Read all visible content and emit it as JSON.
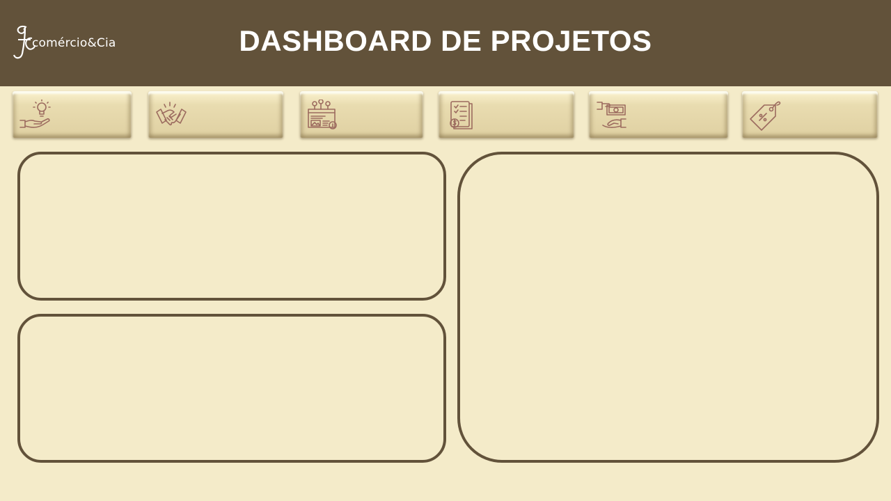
{
  "header": {
    "logo_text": "comércio&Cia",
    "title": "DASHBOARD DE PROJETOS"
  },
  "nav_buttons": [
    {
      "icon": "idea-hand-icon"
    },
    {
      "icon": "handshake-icon"
    },
    {
      "icon": "project-board-icon"
    },
    {
      "icon": "invoice-icon"
    },
    {
      "icon": "payment-hand-icon"
    },
    {
      "icon": "price-tag-icon"
    }
  ],
  "colors": {
    "header_bg": "#62523a",
    "page_bg": "#f4ebc9",
    "icon_stroke": "#9c6b5f",
    "panel_border": "#62523a"
  }
}
